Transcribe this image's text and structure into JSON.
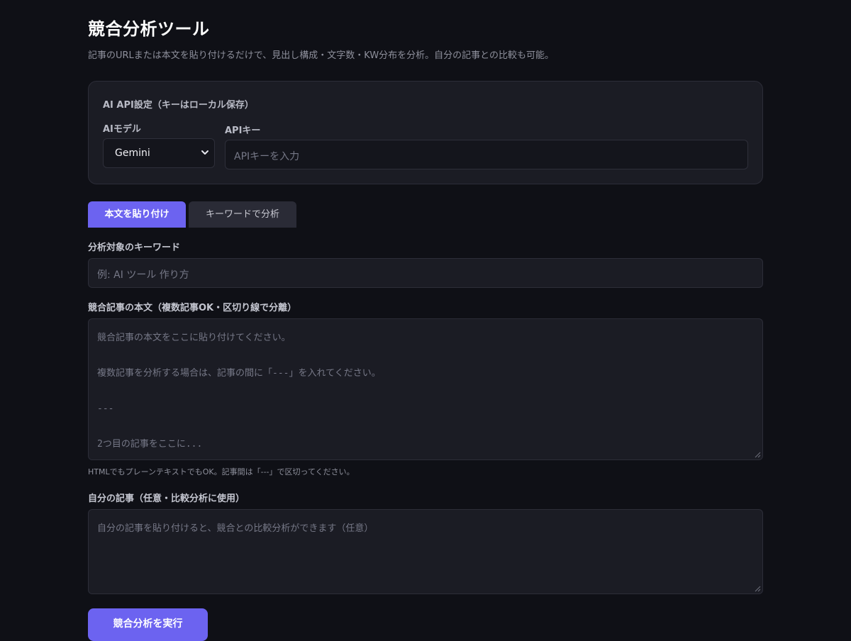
{
  "page": {
    "title": "競合分析ツール",
    "description": "記事のURLまたは本文を貼り付けるだけで、見出し構成・文字数・KW分布を分析。自分の記事との比較も可能。"
  },
  "api_settings": {
    "title": "AI API設定（キーはローカル保存）",
    "model_label": "AIモデル",
    "model_value": "Gemini",
    "key_label": "APIキー",
    "key_placeholder": "APIキーを入力"
  },
  "tabs": [
    {
      "label": "本文を貼り付け",
      "active": true
    },
    {
      "label": "キーワードで分析",
      "active": false
    }
  ],
  "keyword": {
    "label": "分析対象のキーワード",
    "placeholder": "例: AI ツール 作り方"
  },
  "competitor_text": {
    "label": "競合記事の本文（複数記事OK・区切り線で分離）",
    "placeholder": "競合記事の本文をここに貼り付けてください。\n\n複数記事を分析する場合は、記事の間に「---」を入れてください。\n\n---\n\n2つ目の記事をここに...",
    "hint": "HTMLでもプレーンテキストでもOK。記事間は「---」で区切ってください。"
  },
  "own_article": {
    "label": "自分の記事（任意・比較分析に使用）",
    "placeholder": "自分の記事を貼り付けると、競合との比較分析ができます（任意）"
  },
  "actions": {
    "run_label": "競合分析を実行"
  },
  "colors": {
    "background": "#0f1016",
    "card": "#1b1c24",
    "accent": "#6c63f0"
  }
}
